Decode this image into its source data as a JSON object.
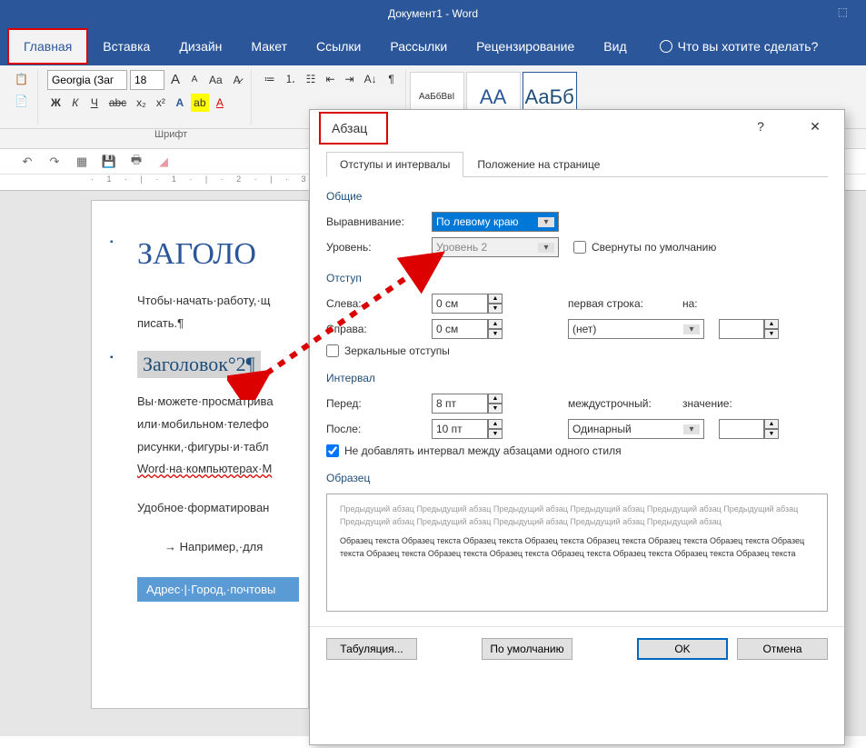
{
  "app": {
    "title": "Документ1 - Word"
  },
  "ribbon_tabs": {
    "home": "Главная",
    "insert": "Вставка",
    "design": "Дизайн",
    "layout": "Макет",
    "references": "Ссылки",
    "mailings": "Рассылки",
    "review": "Рецензирование",
    "view": "Вид",
    "tellme": "Что вы хотите сделать?"
  },
  "ribbon": {
    "font_name": "Georgia (Заг",
    "font_size": "18",
    "bold": "Ж",
    "italic": "К",
    "underline": "Ч",
    "strike": "abc",
    "sub": "x₂",
    "sup": "x²",
    "aa_big": "A",
    "aa_small": "A",
    "case": "Aa",
    "group_font": "Шрифт",
    "styles": {
      "s1": "АаБбВвІ",
      "s2": "АА",
      "s3": "АаБб"
    }
  },
  "doc": {
    "h1": "ЗАГОЛО",
    "p1": "Чтобы·начать·работу,·щ",
    "p1b": "писать.¶",
    "h2": "Заголовок°2¶",
    "p2a": "Вы·можете·просматрива",
    "p2b": "или·мобильном·телефо",
    "p2c": "рисунки,·фигуры·и·табл",
    "p2d": "Word·на·компьютерах·M",
    "p3": "Удобное·форматирован",
    "p4": "→ Например,·для",
    "addr": "Адрес·|·Город,·почтовы"
  },
  "dialog": {
    "title": "Абзац",
    "tabs": {
      "t1": "Отступы и интервалы",
      "t2": "Положение на странице"
    },
    "sec_general": "Общие",
    "align_label": "Выравнивание:",
    "align_val": "По левому краю",
    "level_label": "Уровень:",
    "level_val": "Уровень 2",
    "collapse": "Свернуты по умолчанию",
    "sec_indent": "Отступ",
    "left": "Слева:",
    "right": "Справа:",
    "left_val": "0 см",
    "right_val": "0 см",
    "first_line": "первая строка:",
    "first_val": "(нет)",
    "by": "на:",
    "mirror": "Зеркальные отступы",
    "sec_spacing": "Интервал",
    "before": "Перед:",
    "before_val": "8 пт",
    "after": "После:",
    "after_val": "10 пт",
    "line_sp": "междустрочный:",
    "line_val": "Одинарный",
    "value": "значение:",
    "no_space_same": "Не добавлять интервал между абзацами одного стиля",
    "sec_preview": "Образец",
    "prev_para": "Предыдущий абзац Предыдущий абзац Предыдущий абзац Предыдущий абзац Предыдущий абзац Предыдущий абзац Предыдущий абзац Предыдущий абзац Предыдущий абзац Предыдущий абзац Предыдущий абзац",
    "sample": "Образец текста Образец текста Образец текста Образец текста Образец текста Образец текста Образец текста Образец текста Образец текста Образец текста Образец текста Образец текста Образец текста Образец текста Образец текста",
    "btn_tabs": "Табуляция...",
    "btn_default": "По умолчанию",
    "btn_ok": "OK",
    "btn_cancel": "Отмена"
  }
}
